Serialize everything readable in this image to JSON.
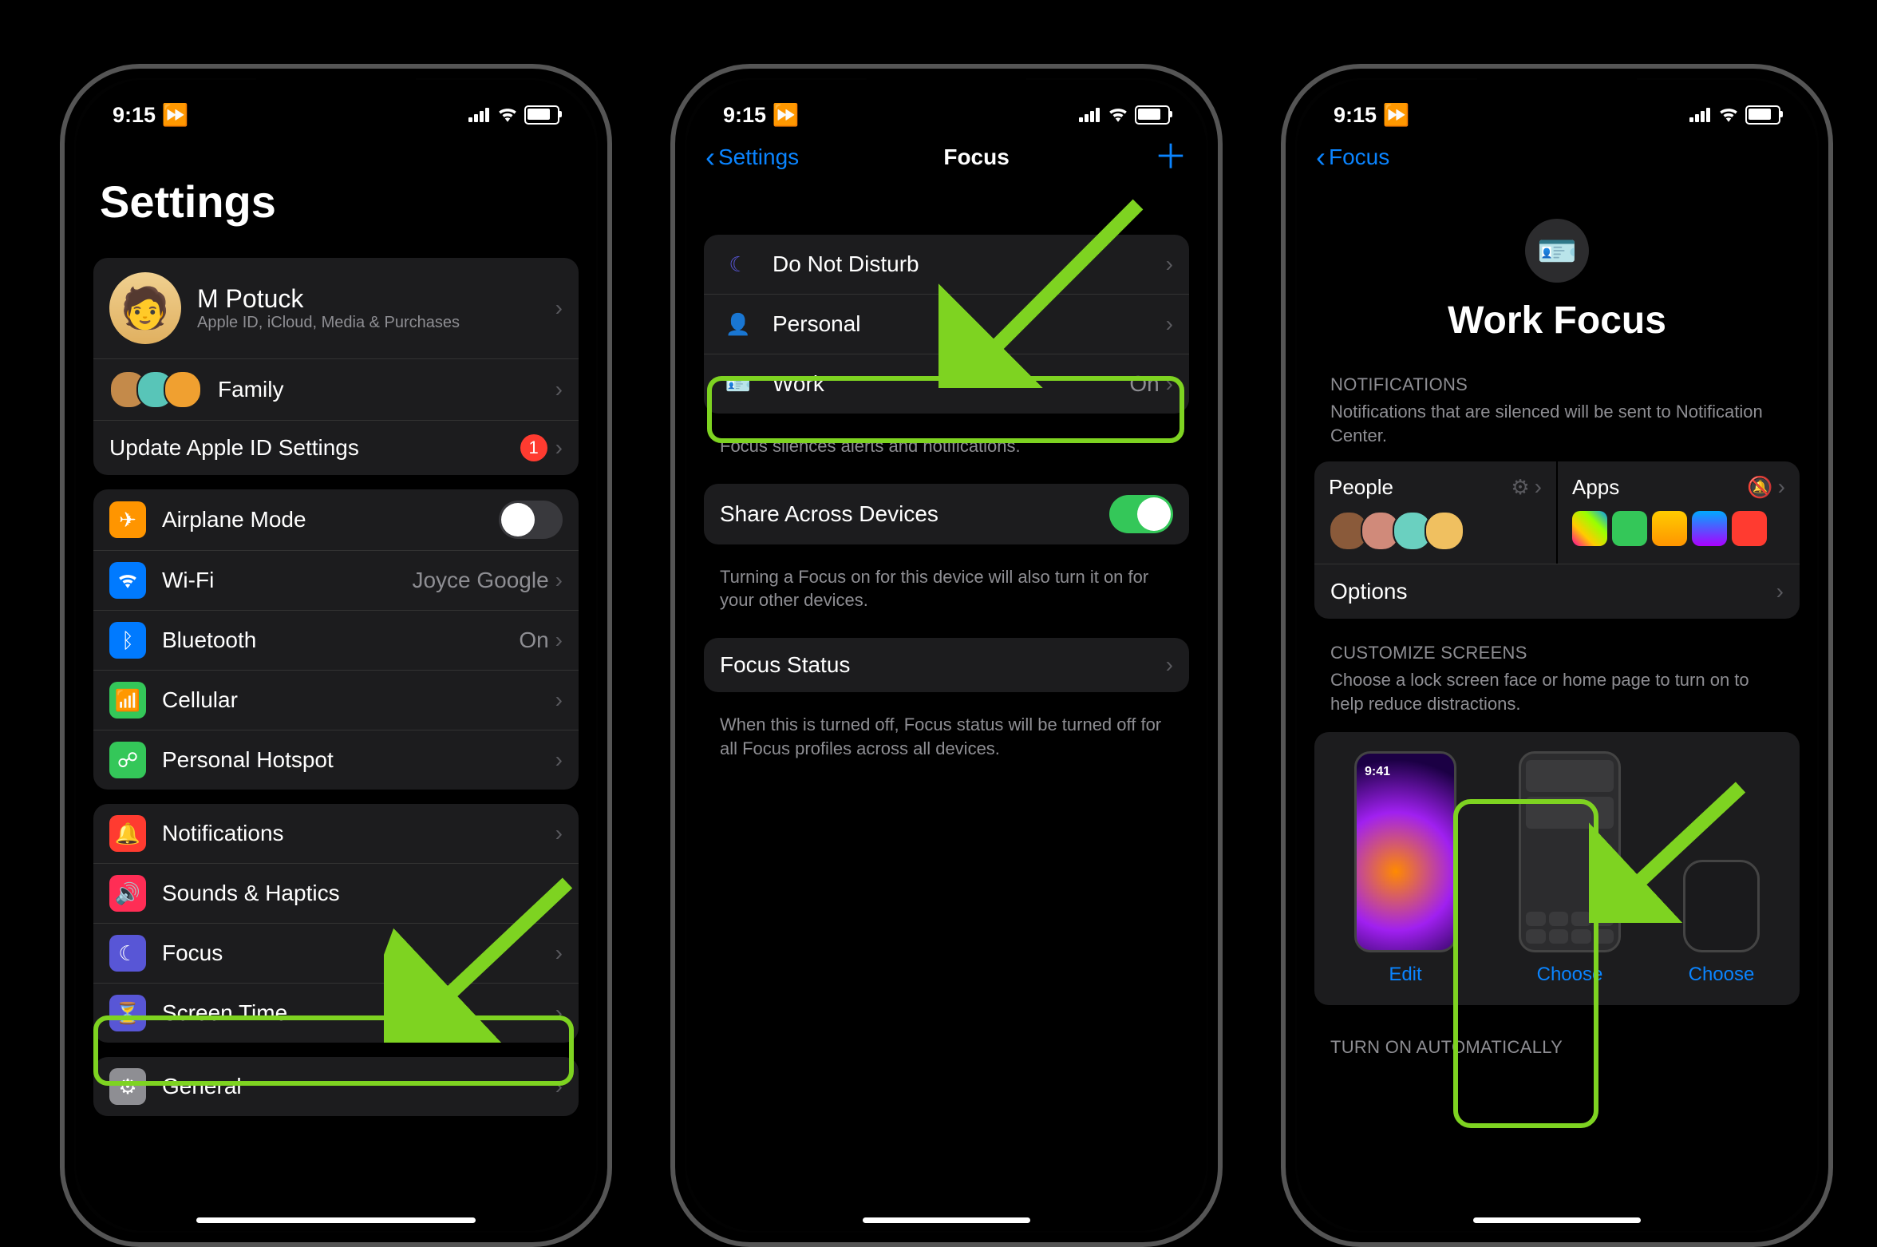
{
  "status": {
    "time": "9:15"
  },
  "phone1": {
    "title": "Settings",
    "profile_name": "M Potuck",
    "profile_sub": "Apple ID, iCloud, Media & Purchases",
    "family": "Family",
    "update": "Update Apple ID Settings",
    "update_badge": "1",
    "airplane": "Airplane Mode",
    "wifi": "Wi-Fi",
    "wifi_val": "Joyce Google",
    "bluetooth": "Bluetooth",
    "bluetooth_val": "On",
    "cellular": "Cellular",
    "hotspot": "Personal Hotspot",
    "notifications": "Notifications",
    "sounds": "Sounds & Haptics",
    "focus": "Focus",
    "screentime": "Screen Time",
    "general": "General"
  },
  "phone2": {
    "back": "Settings",
    "title": "Focus",
    "dnd": "Do Not Disturb",
    "personal": "Personal",
    "work": "Work",
    "work_val": "On",
    "foot1": "Focus silences alerts and notifications.",
    "share": "Share Across Devices",
    "foot2": "Turning a Focus on for this device will also turn it on for your other devices.",
    "focus_status": "Focus Status",
    "foot3": "When this is turned off, Focus status will be turned off for all Focus profiles across all devices."
  },
  "phone3": {
    "back": "Focus",
    "title": "Work Focus",
    "notif_hdr": "NOTIFICATIONS",
    "notif_sub": "Notifications that are silenced will be sent to Notification Center.",
    "people": "People",
    "apps": "Apps",
    "options": "Options",
    "cust_hdr": "CUSTOMIZE SCREENS",
    "cust_sub": "Choose a lock screen face or home page to turn on to help reduce distractions.",
    "edit": "Edit",
    "choose": "Choose",
    "lock_time": "9:41",
    "auto_hdr": "TURN ON AUTOMATICALLY"
  }
}
